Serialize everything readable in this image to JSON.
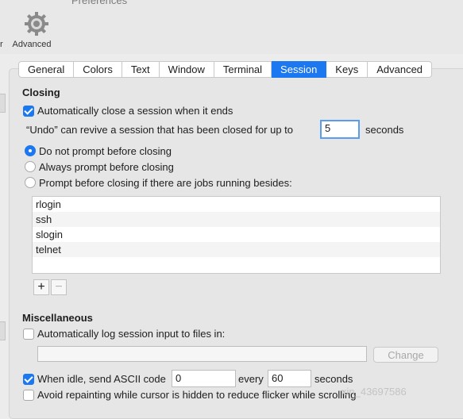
{
  "window": {
    "title": "Preferences"
  },
  "toolbar": {
    "cut_label": "r",
    "advanced_label": "Advanced"
  },
  "tabs": [
    {
      "label": "General",
      "active": false
    },
    {
      "label": "Colors",
      "active": false
    },
    {
      "label": "Text",
      "active": false
    },
    {
      "label": "Window",
      "active": false
    },
    {
      "label": "Terminal",
      "active": false
    },
    {
      "label": "Session",
      "active": true
    },
    {
      "label": "Keys",
      "active": false
    },
    {
      "label": "Advanced",
      "active": false
    }
  ],
  "closing": {
    "heading": "Closing",
    "auto_close_label": "Automatically close a session when it ends",
    "auto_close_checked": true,
    "undo_label": "“Undo” can revive a session that has been closed for up to",
    "undo_value": "5",
    "undo_unit": "seconds",
    "prompt_options": [
      {
        "label": "Do not prompt before closing",
        "selected": true
      },
      {
        "label": "Always prompt before closing",
        "selected": false
      },
      {
        "label": "Prompt before closing if there are jobs running besides:",
        "selected": false
      }
    ],
    "jobs": [
      "rlogin",
      "ssh",
      "slogin",
      "telnet"
    ],
    "add_label": "+",
    "remove_label": "−"
  },
  "misc": {
    "heading": "Miscellaneous",
    "log_label": "Automatically log session input to files in:",
    "log_checked": false,
    "log_path": "",
    "change_label": "Change",
    "idle_label": "When idle, send ASCII code",
    "idle_checked": true,
    "idle_code": "0",
    "every_label": "every",
    "idle_interval": "60",
    "seconds_label": "seconds",
    "repaint_label": "Avoid repainting while cursor is hidden to reduce flicker while scrolling",
    "repaint_checked": false
  },
  "watermark": "xin_43697586",
  "colors": {
    "accent": "#1b78f0"
  }
}
